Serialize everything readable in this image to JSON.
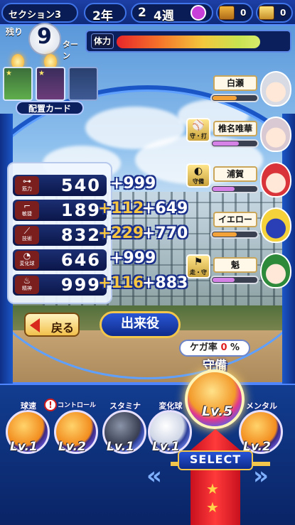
{
  "header": {
    "section_label": "セクション3",
    "year": "2年",
    "month": "2",
    "week": "4週",
    "currency_a": "0",
    "currency_b": "0"
  },
  "turns": {
    "remaining_label": "残り",
    "count": "9",
    "unit": "ターン"
  },
  "stamina": {
    "label": "体力",
    "level": 0.84
  },
  "deploy_card": {
    "label": "配置カード"
  },
  "stats": [
    {
      "icon_text": "筋力",
      "value": "540",
      "bonus1": "",
      "bonus2": "+999"
    },
    {
      "icon_text": "敏捷",
      "value": "189",
      "bonus1": "+112",
      "bonus2": "+649"
    },
    {
      "icon_text": "技術",
      "value": "832",
      "bonus1": "+229",
      "bonus2": "+770"
    },
    {
      "icon_text": "変化球",
      "value": "646",
      "bonus1": "",
      "bonus2": "+999"
    },
    {
      "icon_text": "精神",
      "value": "999",
      "bonus1": "+116",
      "bonus2": "+883"
    }
  ],
  "teammates": [
    {
      "name": "白瀬",
      "tag": "",
      "bond": 0.55,
      "bond_color": "#f3a23a"
    },
    {
      "name": "椎名唯華",
      "tag": "守・打",
      "bond": 0.6,
      "bond_color": "#d681e6"
    },
    {
      "name": "浦賀",
      "tag": "守備",
      "bond": 0.5,
      "bond_color": "#d681e6"
    },
    {
      "name": "イエロー",
      "tag": "",
      "bond": 0.55,
      "bond_color": "#f3a23a"
    },
    {
      "name": "魁",
      "tag": "走・守",
      "bond": 0.5,
      "bond_color": "#d681e6"
    }
  ],
  "buttons": {
    "back": "戻る",
    "combo": "出来役",
    "select": "SELECT"
  },
  "injury": {
    "label": "ケガ率",
    "value": "0",
    "unit": "%"
  },
  "featured_card": {
    "label": "守備",
    "level": "Lv.5"
  },
  "cards": [
    {
      "label": "球速",
      "level": "Lv.1",
      "alert": "!"
    },
    {
      "label": "コントロール",
      "level": "Lv.2",
      "alert": ""
    },
    {
      "label": "スタミナ",
      "level": "Lv.1",
      "alert": ""
    },
    {
      "label": "変化球",
      "level": "Lv.1",
      "alert": ""
    },
    {
      "label": "メンタル",
      "level": "Lv.2",
      "alert": ""
    }
  ],
  "colors": {
    "frame_blue": "#1b56c7",
    "accent_gold": "#f6c542",
    "bonus_outline": "#1a2f8a"
  }
}
